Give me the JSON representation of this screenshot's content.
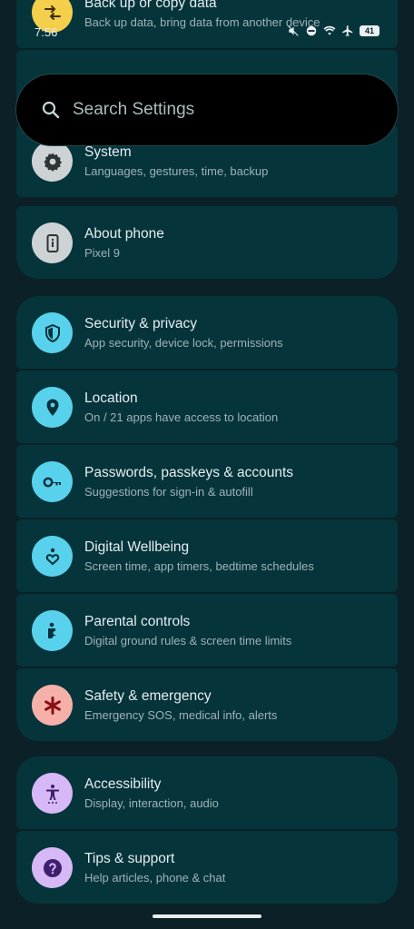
{
  "status_bar": {
    "time": "7:56",
    "battery": "41"
  },
  "search": {
    "placeholder": "Search Settings"
  },
  "groups": [
    {
      "items": [
        {
          "title": "Back up or copy data",
          "subtitle": "Back up data, bring data from another device"
        },
        {
          "title": "System",
          "subtitle": "Languages, gestures, time, backup"
        },
        {
          "title": "About phone",
          "subtitle": "Pixel 9"
        }
      ]
    },
    {
      "items": [
        {
          "title": "Security & privacy",
          "subtitle": "App security, device lock, permissions"
        },
        {
          "title": "Location",
          "subtitle": "On / 21 apps have access to location"
        },
        {
          "title": "Passwords, passkeys & accounts",
          "subtitle": "Suggestions for sign-in & autofill"
        },
        {
          "title": "Digital Wellbeing",
          "subtitle": "Screen time, app timers, bedtime schedules"
        },
        {
          "title": "Parental controls",
          "subtitle": "Digital ground rules & screen time limits"
        },
        {
          "title": "Safety & emergency",
          "subtitle": "Emergency SOS, medical info, alerts"
        }
      ]
    },
    {
      "items": [
        {
          "title": "Accessibility",
          "subtitle": "Display, interaction, audio"
        },
        {
          "title": "Tips & support",
          "subtitle": "Help articles, phone & chat"
        }
      ]
    }
  ],
  "colors": {
    "background": "#0b2027",
    "card": "#06343b",
    "icon_yellow": "#f3cf4b",
    "icon_gray": "#cdd3d4",
    "icon_cyan": "#58d2ec",
    "icon_pink": "#f5b1a9",
    "icon_purple": "#d6b8f6"
  },
  "icons": [
    "backup-transfer-icon",
    "gear-icon",
    "phone-info-icon",
    "shield-icon",
    "location-pin-icon",
    "key-icon",
    "wellbeing-heart-icon",
    "parental-icon",
    "asterisk-icon",
    "accessibility-icon",
    "help-icon"
  ]
}
